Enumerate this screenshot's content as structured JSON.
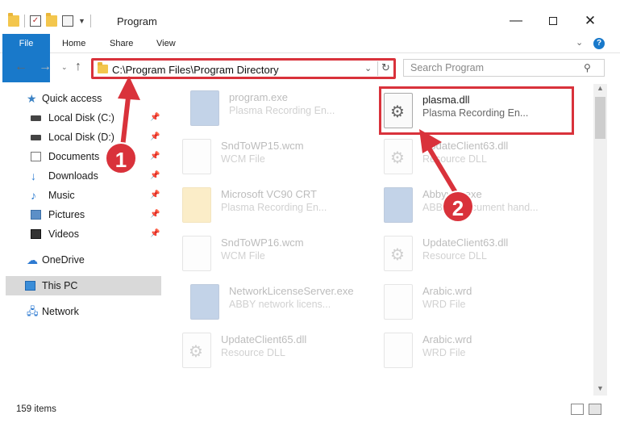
{
  "window": {
    "title": "Program",
    "minimize_glyph": "—",
    "close_glyph": "✕"
  },
  "ribbon": {
    "tabs": [
      "File",
      "Home",
      "Share",
      "View"
    ],
    "help_label": "?"
  },
  "address_bar": {
    "path": "C:\\Program Files\\Program Directory"
  },
  "search": {
    "placeholder": "Search Program"
  },
  "sidebar": {
    "quick_access": "Quick access",
    "items": [
      {
        "label": "Local Disk (C:)",
        "icon": "drive-icon"
      },
      {
        "label": "Local Disk (D:)",
        "icon": "drive-icon"
      },
      {
        "label": "Documents",
        "icon": "documents-icon"
      },
      {
        "label": "Downloads",
        "icon": "downloads-icon"
      },
      {
        "label": "Music",
        "icon": "music-icon"
      },
      {
        "label": "Pictures",
        "icon": "pictures-icon"
      },
      {
        "label": "Videos",
        "icon": "videos-icon"
      }
    ],
    "onedrive": "OneDrive",
    "this_pc": "This PC",
    "network": "Network"
  },
  "files": [
    {
      "name": "program.exe",
      "desc": "Plasma Recording En...",
      "icon": "exe-icon"
    },
    {
      "name": "plasma.dll",
      "desc": "Plasma Recording En...",
      "icon": "dll-gear-icon"
    },
    {
      "name": "SndToWP15.wcm",
      "desc": "WCM File",
      "icon": "file-icon"
    },
    {
      "name": "UpdateClient63.dll",
      "desc": "Resource DLL",
      "icon": "dll-gear-icon"
    },
    {
      "name": "Microsoft VC90 CRT",
      "desc": "Plasma Recording En...",
      "icon": "folder-icon"
    },
    {
      "name": "AbbyyID.exe",
      "desc": "ABBYY Document hand...",
      "icon": "exe-icon"
    },
    {
      "name": "SndToWP16.wcm",
      "desc": "WCM File",
      "icon": "file-icon"
    },
    {
      "name": "UpdateClient63.dll",
      "desc": "Resource DLL",
      "icon": "dll-gear-icon"
    },
    {
      "name": "NetworkLicenseServer.exe",
      "desc": "ABBY network licens...",
      "icon": "exe-icon"
    },
    {
      "name": "Arabic.wrd",
      "desc": "WRD File",
      "icon": "file-icon"
    },
    {
      "name": "UpdateClient65.dll",
      "desc": "Resource DLL",
      "icon": "dll-gear-icon"
    },
    {
      "name": "Arabic.wrd",
      "desc": "WRD File",
      "icon": "file-icon"
    }
  ],
  "status": {
    "item_count": "159 items"
  },
  "callouts": [
    "1",
    "2"
  ],
  "colors": {
    "accent": "#1979ca",
    "highlight": "#d9323b"
  }
}
